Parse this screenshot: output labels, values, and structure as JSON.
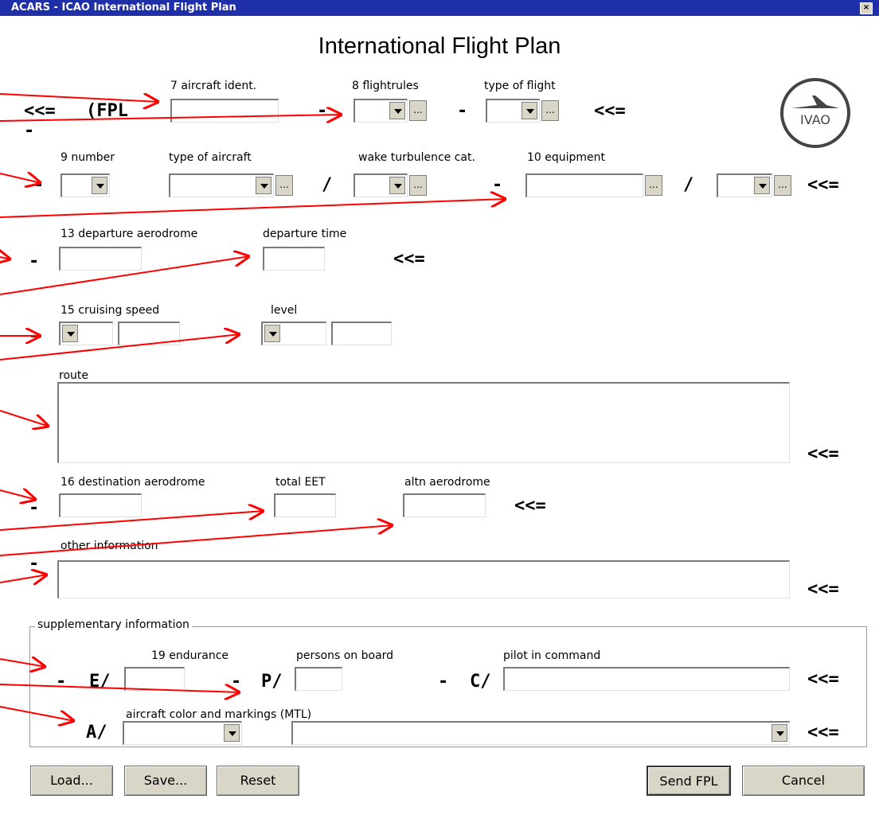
{
  "window": {
    "title": "ACARS - ICAO International Flight Plan",
    "close": "×"
  },
  "heading": "International Flight Plan",
  "logo_text": "IVAO",
  "markers": {
    "arrow": "<<=",
    "fpl": "(FPL",
    "dash": "-",
    "slash": "/",
    "e": "E/",
    "p": "P/",
    "c": "C/",
    "a": "A/"
  },
  "fields": {
    "aircraft_ident": {
      "label": "7 aircraft ident.",
      "value": ""
    },
    "flightrules": {
      "label": "8 flightrules",
      "value": ""
    },
    "type_of_flight": {
      "label": "type of flight",
      "value": ""
    },
    "number": {
      "label": "9 number",
      "value": ""
    },
    "type_of_aircraft": {
      "label": "type of aircraft",
      "value": ""
    },
    "wake_turbulence": {
      "label": "wake turbulence cat.",
      "value": ""
    },
    "equipment": {
      "label": "10 equipment",
      "value": ""
    },
    "departure_aerodrome": {
      "label": "13 departure aerodrome",
      "value": ""
    },
    "departure_time": {
      "label": "departure time",
      "value": ""
    },
    "cruising_speed": {
      "label": "15 cruising speed",
      "value": ""
    },
    "level": {
      "label": "level",
      "value": ""
    },
    "route": {
      "label": "route",
      "value": ""
    },
    "destination_aerodrome": {
      "label": "16 destination aerodrome",
      "value": ""
    },
    "total_eet": {
      "label": "total EET",
      "value": ""
    },
    "altn_aerodrome": {
      "label": "altn aerodrome",
      "value": ""
    },
    "other_information": {
      "label": "other information",
      "value": ""
    },
    "endurance": {
      "label": "19 endurance",
      "value": ""
    },
    "persons_on_board": {
      "label": "persons on board",
      "value": ""
    },
    "pilot_in_command": {
      "label": "pilot in command",
      "value": ""
    },
    "color_markings": {
      "label": "aircraft color and markings (MTL)",
      "value": ""
    }
  },
  "supplementary_label": "supplementary information",
  "ellipsis": "...",
  "buttons": {
    "load": "Load...",
    "save": "Save...",
    "reset": "Reset",
    "send": "Send FPL",
    "cancel": "Cancel"
  },
  "colors": {
    "titlebar": "#1f2fa8",
    "arrow": "#ff0000",
    "button": "#d9d6c8"
  }
}
